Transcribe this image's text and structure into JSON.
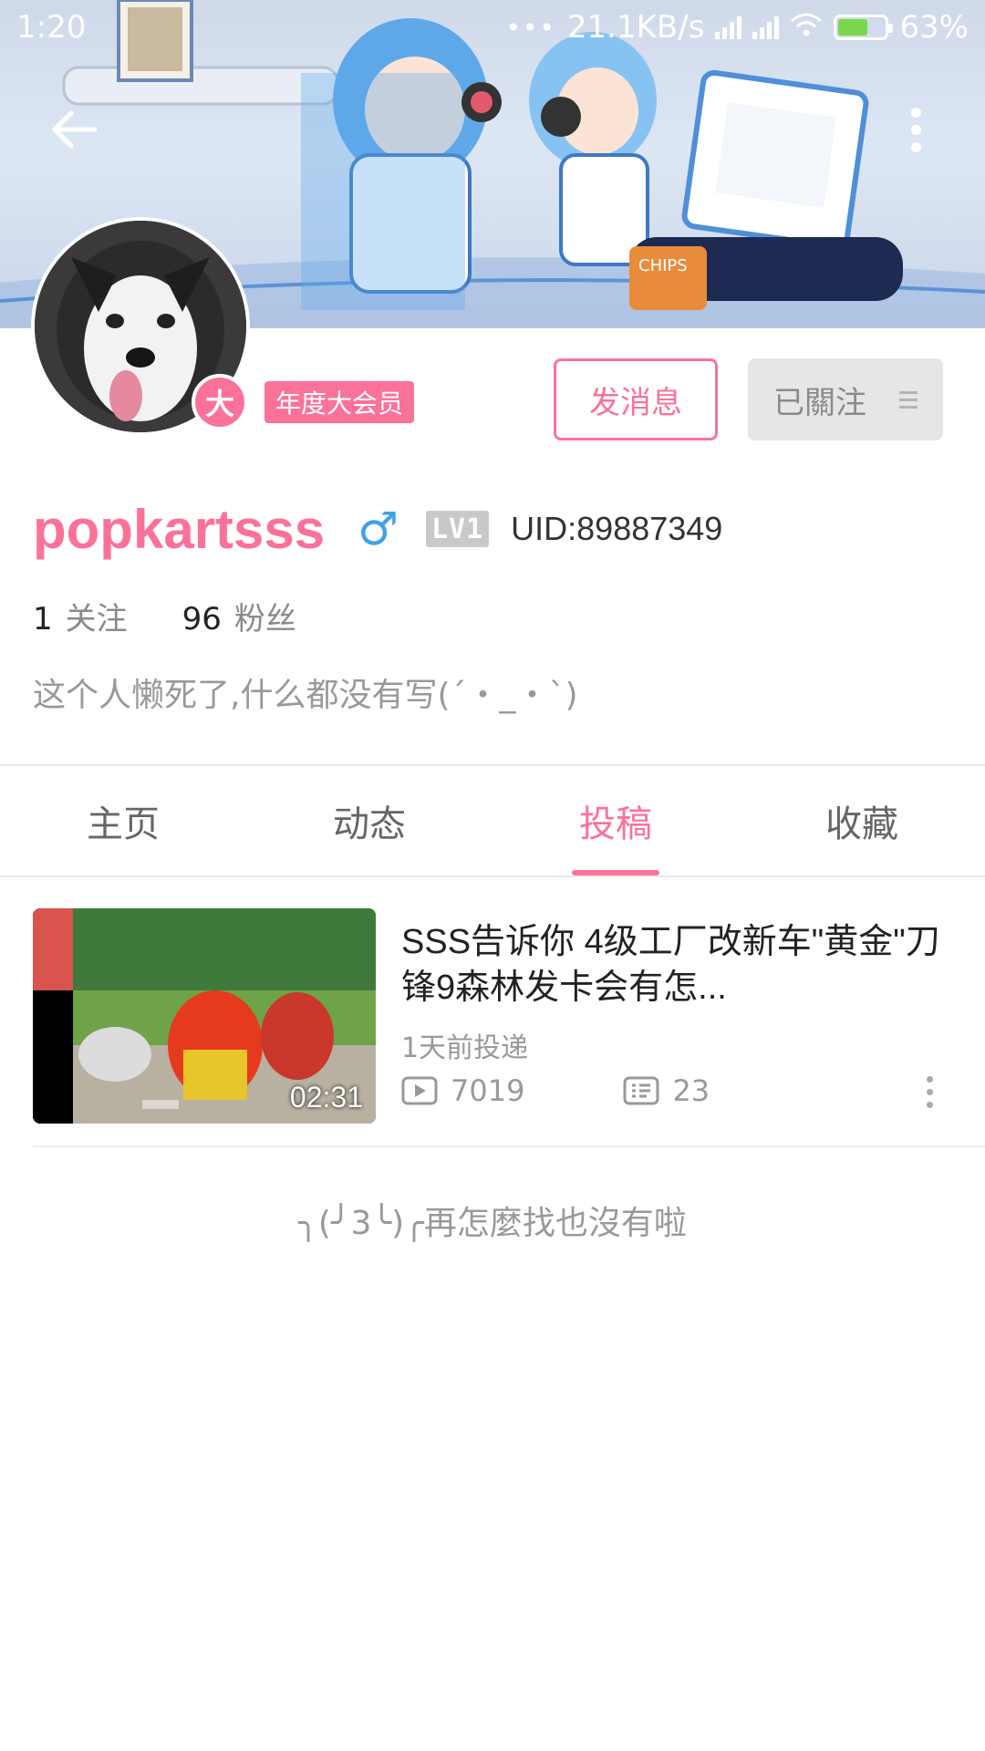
{
  "status_bar": {
    "time": "1:20",
    "dots": "•••",
    "network_speed": "21.1KB/s",
    "battery": "63%",
    "battery_level": 0.63
  },
  "header": {
    "back_icon": "arrow-left-icon",
    "more_icon": "more-vertical-icon"
  },
  "profile": {
    "avatar_icon": "dog-avatar",
    "vip_badge": "大",
    "vip_label": "年度大会员",
    "message_button": "发消息",
    "follow_button": "已關注",
    "username": "popkartsss",
    "gender_icon": "♂",
    "level": "LV1",
    "uid": "UID:89887349",
    "following_count": "1",
    "following_label": "关注",
    "followers_count": "96",
    "followers_label": "粉丝",
    "bio": "这个人懒死了,什么都没有写(´・_・`)"
  },
  "tabs": [
    {
      "label": "主页",
      "active": false
    },
    {
      "label": "动态",
      "active": false
    },
    {
      "label": "投稿",
      "active": true
    },
    {
      "label": "收藏",
      "active": false
    }
  ],
  "videos": [
    {
      "title": "SSS告诉你 4级工厂改新车\"黄金\"刀锋9森林发卡会有怎...",
      "duration": "02:31",
      "posted": "1天前投递",
      "plays": "7019",
      "comments": "23",
      "play_icon": "play-count-icon",
      "comment_icon": "danmaku-icon"
    }
  ],
  "end_note": "╮(╯3╰)╭再怎麼找也沒有啦",
  "colors": {
    "accent": "#fb7299",
    "gender_blue": "#3fa1e8",
    "muted": "#999999"
  }
}
